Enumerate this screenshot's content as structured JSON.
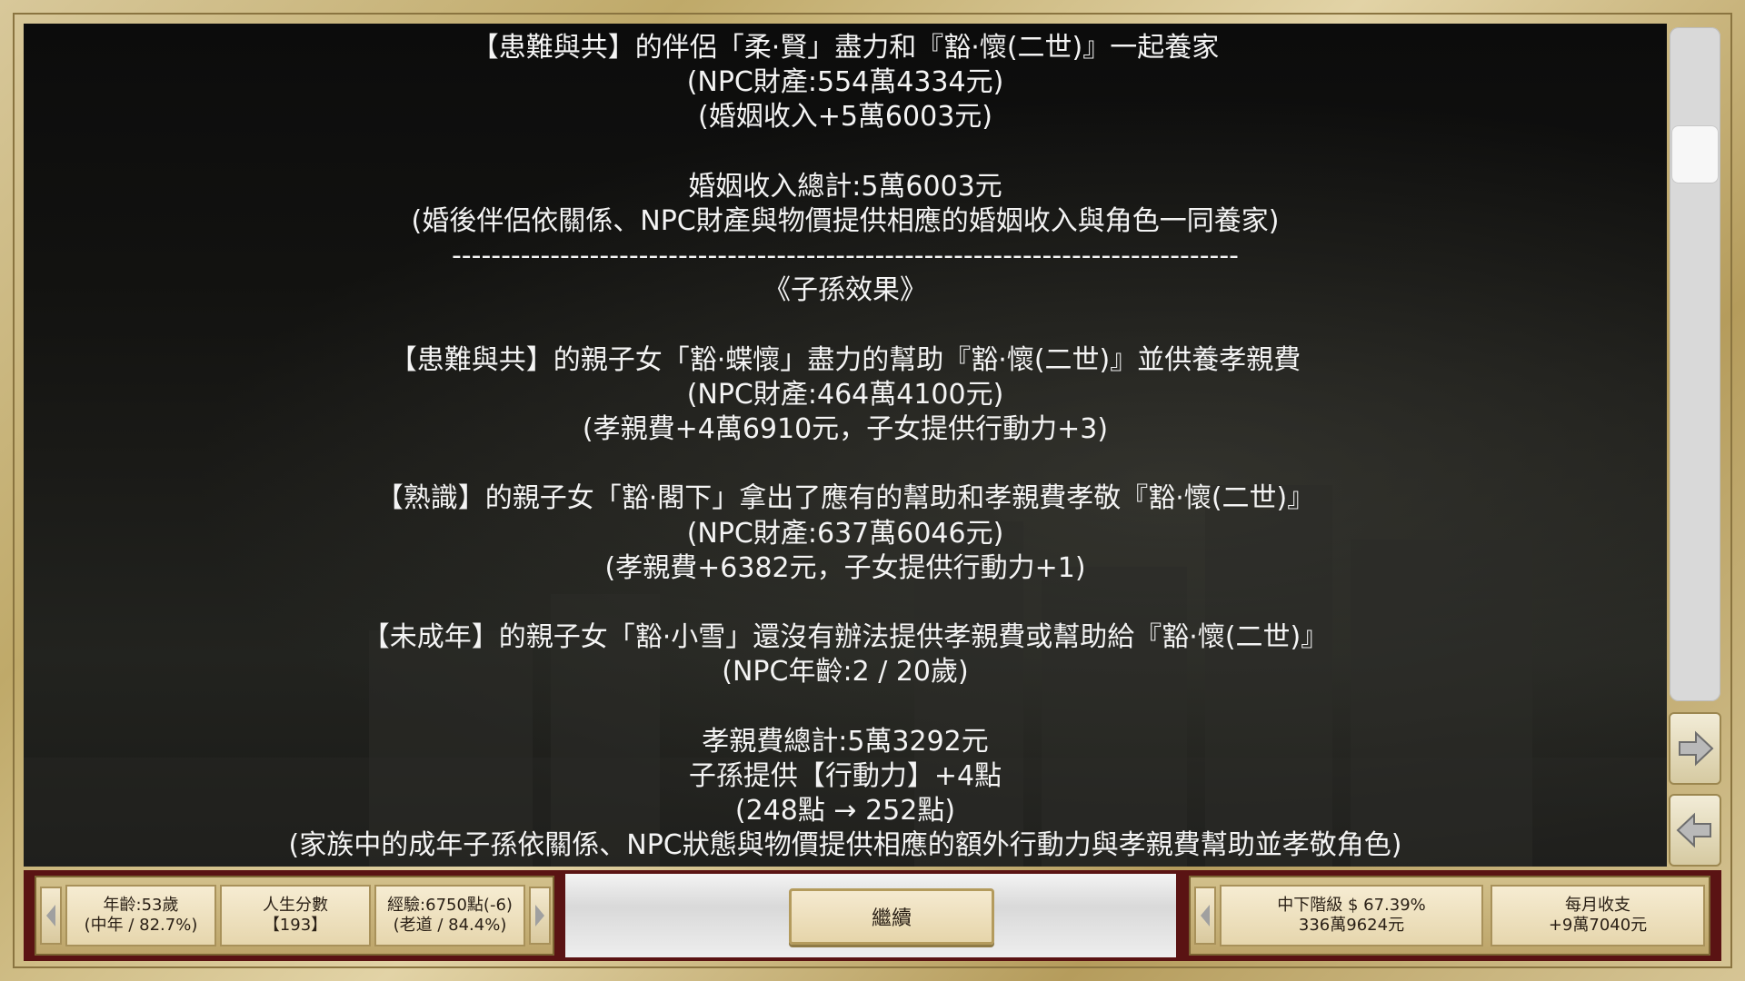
{
  "story": {
    "lines": [
      "【患難與共】的伴侶「柔·賢」盡力和『豁·懷(二世)』一起養家",
      "(NPC財產:554萬4334元)",
      "(婚姻收入+5萬6003元)",
      "",
      "婚姻收入總計:5萬6003元",
      "(婚後伴侶依關係、NPC財產與物價提供相應的婚姻收入與角色一同養家)",
      "--------------------------------------------------------------------------------",
      "《子孫效果》",
      "",
      "【患難與共】的親子女「豁·蝶懷」盡力的幫助『豁·懷(二世)』並供養孝親費",
      "(NPC財產:464萬4100元)",
      "(孝親費+4萬6910元，子女提供行動力+3)",
      "",
      "【熟識】的親子女「豁·閣下」拿出了應有的幫助和孝親費孝敬『豁·懷(二世)』",
      "(NPC財產:637萬6046元)",
      "(孝親費+6382元，子女提供行動力+1)",
      "",
      "【未成年】的親子女「豁·小雪」還沒有辦法提供孝親費或幫助給『豁·懷(二世)』",
      "(NPC年齡:2 / 20歲)",
      "",
      "孝親費總計:5萬3292元",
      "子孫提供【行動力】+4點",
      "(248點 → 252點)",
      "(家族中的成年子孫依關係、NPC狀態與物價提供相應的額外行動力與孝親費幫助並孝敬角色)"
    ]
  },
  "scroll": {
    "thumb_position": 0.16
  },
  "side_buttons": {
    "next_icon": "right-arrow-icon",
    "prev_icon": "left-arrow-icon"
  },
  "status_left": {
    "age_line1": "年齡:53歲",
    "age_line2": "(中年 / 82.7%)",
    "score_line1": "人生分數",
    "score_line2": "【193】",
    "exp_line1": "經驗:6750點(-6)",
    "exp_line2": "(老道 / 84.4%)"
  },
  "continue_label": "繼續",
  "status_right": {
    "class_line1": "中下階級 $ 67.39%",
    "class_line2": "336萬9624元",
    "monthly_line1": "每月收支",
    "monthly_line2": "+9萬7040元"
  },
  "colors": {
    "accent_gold": "#bfa969",
    "bar_red": "#5a1313"
  }
}
